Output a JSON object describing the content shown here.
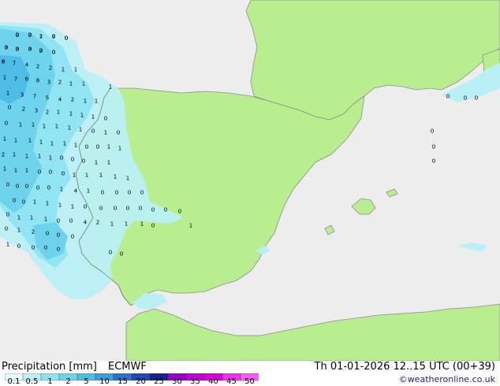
{
  "legend": {
    "title": "Precipitation [mm]",
    "model": "ECMWF",
    "levels": [
      "0.1",
      "0.5",
      "1",
      "2",
      "5",
      "10",
      "15",
      "20",
      "25",
      "30",
      "35",
      "40",
      "45",
      "50"
    ],
    "colors": [
      "#e6f9fb",
      "#b9f0f6",
      "#8ee3f0",
      "#6dd3ec",
      "#4dbde6",
      "#3a9ee0",
      "#2b73cf",
      "#2048b8",
      "#10238f",
      "#9a00cc",
      "#c400dd",
      "#dd00dd",
      "#ea33ea",
      "#f55bf5"
    ]
  },
  "run_info": "Th 01-01-2026 12..15 UTC (00+39)",
  "credit": "©weatheronline.co.uk",
  "map": {
    "land_color": "#b9ee8f",
    "sea_color": "#ededed",
    "coast_color": "#808080",
    "labels": [
      "2",
      "2",
      "2",
      "1",
      "0",
      "3",
      "3",
      "3",
      "2",
      "0",
      "8",
      "7",
      "4",
      "2",
      "2",
      "1",
      "1",
      "1",
      "7",
      "6",
      "8",
      "3",
      "2",
      "1",
      "1",
      "1",
      "3",
      "7",
      "5",
      "4",
      "2",
      "1",
      "1",
      "1",
      "0",
      "2",
      "3",
      "2",
      "1",
      "1",
      "1",
      "1",
      "0",
      "0",
      "1",
      "1",
      "1",
      "1",
      "1",
      "1",
      "0",
      "1",
      "0",
      "1",
      "1",
      "1",
      "1",
      "1",
      "1",
      "1",
      "0",
      "0",
      "1",
      "1",
      "2",
      "1",
      "1",
      "1",
      "1",
      "0",
      "0",
      "0",
      "1",
      "1",
      "1",
      "1",
      "1",
      "0",
      "0",
      "0",
      "1",
      "1",
      "1",
      "1",
      "1",
      "0",
      "0",
      "0",
      "0",
      "0",
      "1",
      "4",
      "1",
      "0",
      "0",
      "0",
      "0",
      "0",
      "0",
      "1",
      "1",
      "1",
      "1",
      "0",
      "0",
      "0",
      "0",
      "0",
      "0",
      "0",
      "0",
      "0",
      "1",
      "1",
      "1",
      "0",
      "0",
      "4",
      "2",
      "1",
      "1",
      "1",
      "0",
      "1",
      "2",
      "0",
      "0",
      "0",
      "0",
      "1",
      "0",
      "0",
      "0",
      "1",
      "0",
      "0",
      "0",
      "0",
      "0",
      "0",
      "0",
      "0",
      "0",
      "0",
      "0",
      "1",
      "0",
      "0",
      "0",
      "0",
      "0",
      "0",
      "0",
      "0"
    ]
  }
}
